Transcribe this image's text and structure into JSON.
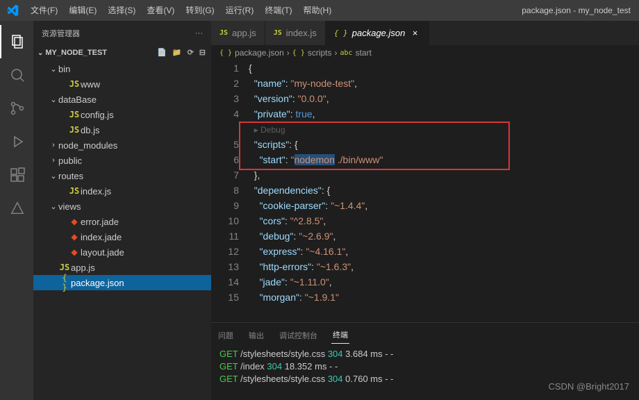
{
  "titlebar": {
    "title": "package.json - my_node_test",
    "menu": [
      "文件(F)",
      "编辑(E)",
      "选择(S)",
      "查看(V)",
      "转到(G)",
      "运行(R)",
      "终端(T)",
      "帮助(H)"
    ]
  },
  "sidebar": {
    "title": "资源管理器",
    "folder": "MY_NODE_TEST",
    "tree": [
      {
        "type": "folder",
        "label": "bin",
        "depth": 1,
        "open": true
      },
      {
        "type": "file",
        "label": "www",
        "depth": 2,
        "icon": "js"
      },
      {
        "type": "folder",
        "label": "dataBase",
        "depth": 1,
        "open": true
      },
      {
        "type": "file",
        "label": "config.js",
        "depth": 2,
        "icon": "js"
      },
      {
        "type": "file",
        "label": "db.js",
        "depth": 2,
        "icon": "js"
      },
      {
        "type": "folder",
        "label": "node_modules",
        "depth": 1,
        "open": false
      },
      {
        "type": "folder",
        "label": "public",
        "depth": 1,
        "open": false
      },
      {
        "type": "folder",
        "label": "routes",
        "depth": 1,
        "open": true
      },
      {
        "type": "file",
        "label": "index.js",
        "depth": 2,
        "icon": "js"
      },
      {
        "type": "folder",
        "label": "views",
        "depth": 1,
        "open": true
      },
      {
        "type": "file",
        "label": "error.jade",
        "depth": 2,
        "icon": "jade"
      },
      {
        "type": "file",
        "label": "index.jade",
        "depth": 2,
        "icon": "jade"
      },
      {
        "type": "file",
        "label": "layout.jade",
        "depth": 2,
        "icon": "jade"
      },
      {
        "type": "file",
        "label": "app.js",
        "depth": 1,
        "icon": "js"
      },
      {
        "type": "file",
        "label": "package.json",
        "depth": 1,
        "icon": "json",
        "selected": true
      }
    ]
  },
  "tabs": [
    {
      "icon": "js",
      "label": "app.js",
      "active": false
    },
    {
      "icon": "js",
      "label": "index.js",
      "active": false
    },
    {
      "icon": "json",
      "label": "package.json",
      "active": true
    }
  ],
  "breadcrumbs": [
    {
      "icon": "{ }",
      "label": "package.json"
    },
    {
      "icon": "{ }",
      "label": "scripts"
    },
    {
      "icon": "abc",
      "label": "start"
    }
  ],
  "code": {
    "start_line": 1,
    "lines": [
      {
        "n": 1,
        "tokens": [
          [
            "punc",
            "{"
          ]
        ]
      },
      {
        "n": 2,
        "tokens": [
          [
            "punc",
            "  "
          ],
          [
            "key",
            "\"name\""
          ],
          [
            "punc",
            ": "
          ],
          [
            "str",
            "\"my-node-test\""
          ],
          [
            "punc",
            ","
          ]
        ]
      },
      {
        "n": 3,
        "tokens": [
          [
            "punc",
            "  "
          ],
          [
            "key",
            "\"version\""
          ],
          [
            "punc",
            ": "
          ],
          [
            "str",
            "\"0.0.0\""
          ],
          [
            "punc",
            ","
          ]
        ]
      },
      {
        "n": 4,
        "tokens": [
          [
            "punc",
            "  "
          ],
          [
            "key",
            "\"private\""
          ],
          [
            "punc",
            ": "
          ],
          [
            "kw",
            "true"
          ],
          [
            "punc",
            ","
          ]
        ]
      },
      {
        "n": null,
        "debug": "▸ Debug"
      },
      {
        "n": 5,
        "tokens": [
          [
            "punc",
            "  "
          ],
          [
            "key",
            "\"scripts\""
          ],
          [
            "punc",
            ": {"
          ]
        ]
      },
      {
        "n": 6,
        "tokens": [
          [
            "punc",
            "    "
          ],
          [
            "key",
            "\"start\""
          ],
          [
            "punc",
            ": "
          ],
          [
            "str",
            "\""
          ],
          [
            "strhl",
            "nodemon"
          ],
          [
            "str",
            " ./bin/www\""
          ]
        ]
      },
      {
        "n": 7,
        "tokens": [
          [
            "punc",
            "  },"
          ]
        ]
      },
      {
        "n": 8,
        "tokens": [
          [
            "punc",
            "  "
          ],
          [
            "key",
            "\"dependencies\""
          ],
          [
            "punc",
            ": {"
          ]
        ]
      },
      {
        "n": 9,
        "tokens": [
          [
            "punc",
            "    "
          ],
          [
            "key",
            "\"cookie-parser\""
          ],
          [
            "punc",
            ": "
          ],
          [
            "str",
            "\"~1.4.4\""
          ],
          [
            "punc",
            ","
          ]
        ]
      },
      {
        "n": 10,
        "tokens": [
          [
            "punc",
            "    "
          ],
          [
            "key",
            "\"cors\""
          ],
          [
            "punc",
            ": "
          ],
          [
            "str",
            "\"^2.8.5\""
          ],
          [
            "punc",
            ","
          ]
        ]
      },
      {
        "n": 11,
        "tokens": [
          [
            "punc",
            "    "
          ],
          [
            "key",
            "\"debug\""
          ],
          [
            "punc",
            ": "
          ],
          [
            "str",
            "\"~2.6.9\""
          ],
          [
            "punc",
            ","
          ]
        ]
      },
      {
        "n": 12,
        "tokens": [
          [
            "punc",
            "    "
          ],
          [
            "key",
            "\"express\""
          ],
          [
            "punc",
            ": "
          ],
          [
            "str",
            "\"~4.16.1\""
          ],
          [
            "punc",
            ","
          ]
        ]
      },
      {
        "n": 13,
        "tokens": [
          [
            "punc",
            "    "
          ],
          [
            "key",
            "\"http-errors\""
          ],
          [
            "punc",
            ": "
          ],
          [
            "str",
            "\"~1.6.3\""
          ],
          [
            "punc",
            ","
          ]
        ]
      },
      {
        "n": 14,
        "tokens": [
          [
            "punc",
            "    "
          ],
          [
            "key",
            "\"jade\""
          ],
          [
            "punc",
            ": "
          ],
          [
            "str",
            "\"~1.11.0\""
          ],
          [
            "punc",
            ","
          ]
        ]
      },
      {
        "n": 15,
        "tokens": [
          [
            "punc",
            "    "
          ],
          [
            "key",
            "\"morgan\""
          ],
          [
            "punc",
            ": "
          ],
          [
            "str",
            "\"~1.9.1\""
          ]
        ]
      }
    ]
  },
  "panel": {
    "tabs": [
      "问题",
      "输出",
      "调试控制台",
      "终端"
    ],
    "active_tab": 3,
    "terminal_lines": [
      [
        [
          "green",
          "GET"
        ],
        [
          "plain",
          " /stylesheets/style.css "
        ],
        [
          "cyan",
          "304"
        ],
        [
          "plain",
          " 3.684 ms - -"
        ]
      ],
      [
        [
          "green",
          "GET"
        ],
        [
          "plain",
          " /index "
        ],
        [
          "cyan",
          "304"
        ],
        [
          "plain",
          " 18.352 ms - -"
        ]
      ],
      [
        [
          "green",
          "GET"
        ],
        [
          "plain",
          " /stylesheets/style.css "
        ],
        [
          "cyan",
          "304"
        ],
        [
          "plain",
          " 0.760 ms - -"
        ]
      ]
    ]
  },
  "watermark": "CSDN @Bright2017"
}
